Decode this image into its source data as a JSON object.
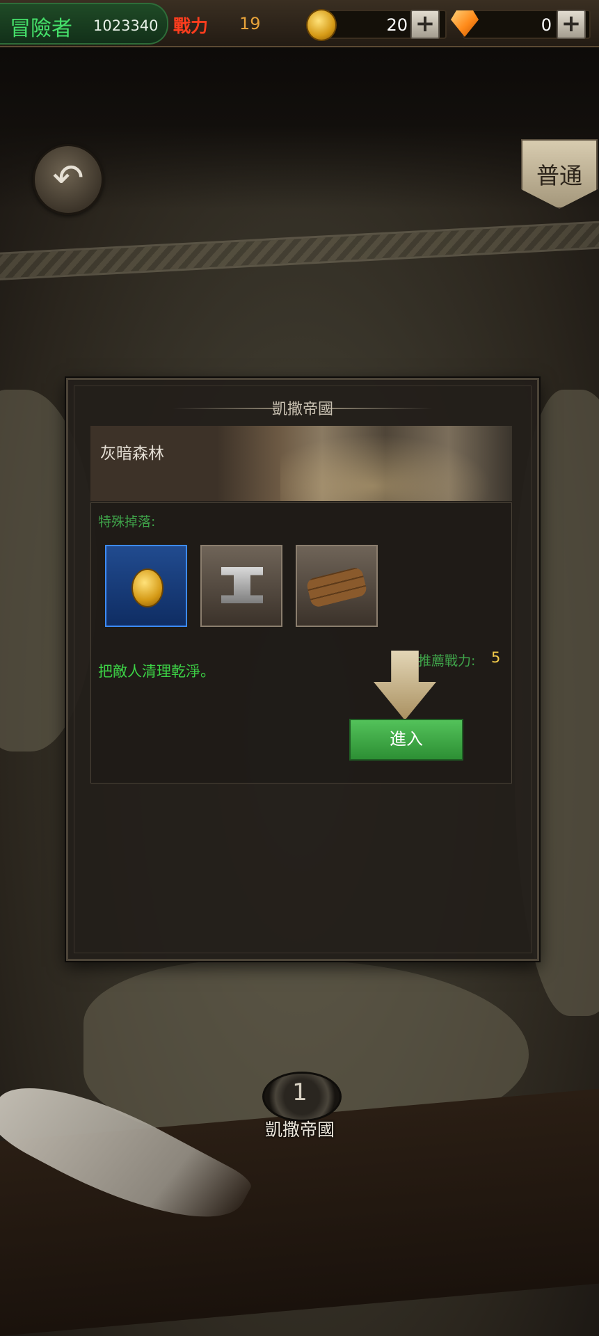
{
  "status_bar": {
    "player_title": "冒險者",
    "player_id": "1023340",
    "power_label": "戰力",
    "power_value": "19",
    "gold_value": "20",
    "gem_value": "0",
    "plus_symbol": "+",
    "gold_icon": "gold-coin-icon",
    "gem_icon": "gem-icon"
  },
  "header": {
    "back_icon": "back-arrow-icon",
    "difficulty_label": "普通"
  },
  "stage_panel": {
    "region_title": "凱撒帝國",
    "stage_name": "灰暗森林",
    "special_drops_label": "特殊掉落:",
    "drops": [
      {
        "icon": "gold-coin-icon",
        "selected": true
      },
      {
        "icon": "iron-anvil-icon",
        "selected": false
      },
      {
        "icon": "wood-logs-icon",
        "selected": false
      }
    ],
    "objective_text": "把敵人清理乾淨。",
    "recommended_power_label": "推薦戰力:",
    "recommended_power_value": "5",
    "enter_button_label": "進入"
  },
  "map": {
    "stage_number": "1",
    "stage_region_label": "凱撒帝國"
  },
  "colors": {
    "green_text": "#3cd246",
    "power_red": "#ff3d1e",
    "enter_button": "#3da944",
    "selected_slot": "#3d8bff"
  }
}
